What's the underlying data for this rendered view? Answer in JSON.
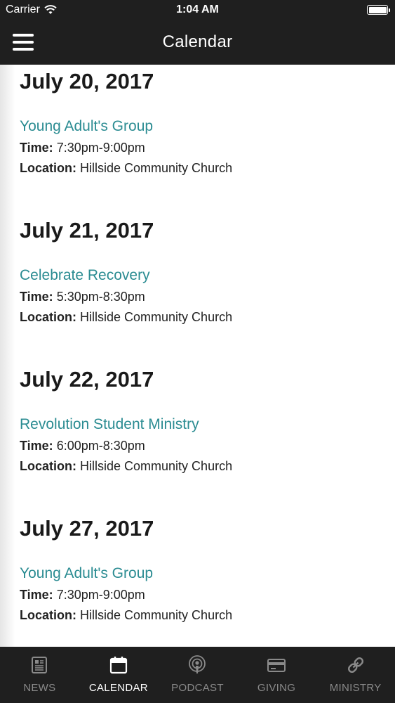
{
  "status_bar": {
    "carrier": "Carrier",
    "time": "1:04 AM"
  },
  "nav": {
    "title": "Calendar"
  },
  "days": [
    {
      "date": "July 20, 2017",
      "event": "Young Adult's Group",
      "time_label": "Time:",
      "time": "7:30pm-9:00pm",
      "location_label": "Location:",
      "location": "Hillside Community Church"
    },
    {
      "date": "July 21, 2017",
      "event": "Celebrate Recovery",
      "time_label": "Time:",
      "time": "5:30pm-8:30pm",
      "location_label": "Location:",
      "location": "Hillside Community Church"
    },
    {
      "date": "July 22, 2017",
      "event": "Revolution Student Ministry",
      "time_label": "Time:",
      "time": "6:00pm-8:30pm",
      "location_label": "Location:",
      "location": "Hillside Community Church"
    },
    {
      "date": "July 27, 2017",
      "event": "Young Adult's Group",
      "time_label": "Time:",
      "time": "7:30pm-9:00pm",
      "location_label": "Location:",
      "location": "Hillside Community Church"
    }
  ],
  "tabs": [
    {
      "label": "NEWS",
      "icon": "newspaper-icon"
    },
    {
      "label": "CALENDAR",
      "icon": "calendar-icon",
      "active": true
    },
    {
      "label": "PODCAST",
      "icon": "podcast-icon"
    },
    {
      "label": "GIVING",
      "icon": "credit-card-icon"
    },
    {
      "label": "MINISTRY",
      "icon": "link-icon"
    }
  ],
  "colors": {
    "bar_bg": "#1f1f1f",
    "accent": "#2b8c92",
    "tab_inactive": "#8a8a8a"
  }
}
